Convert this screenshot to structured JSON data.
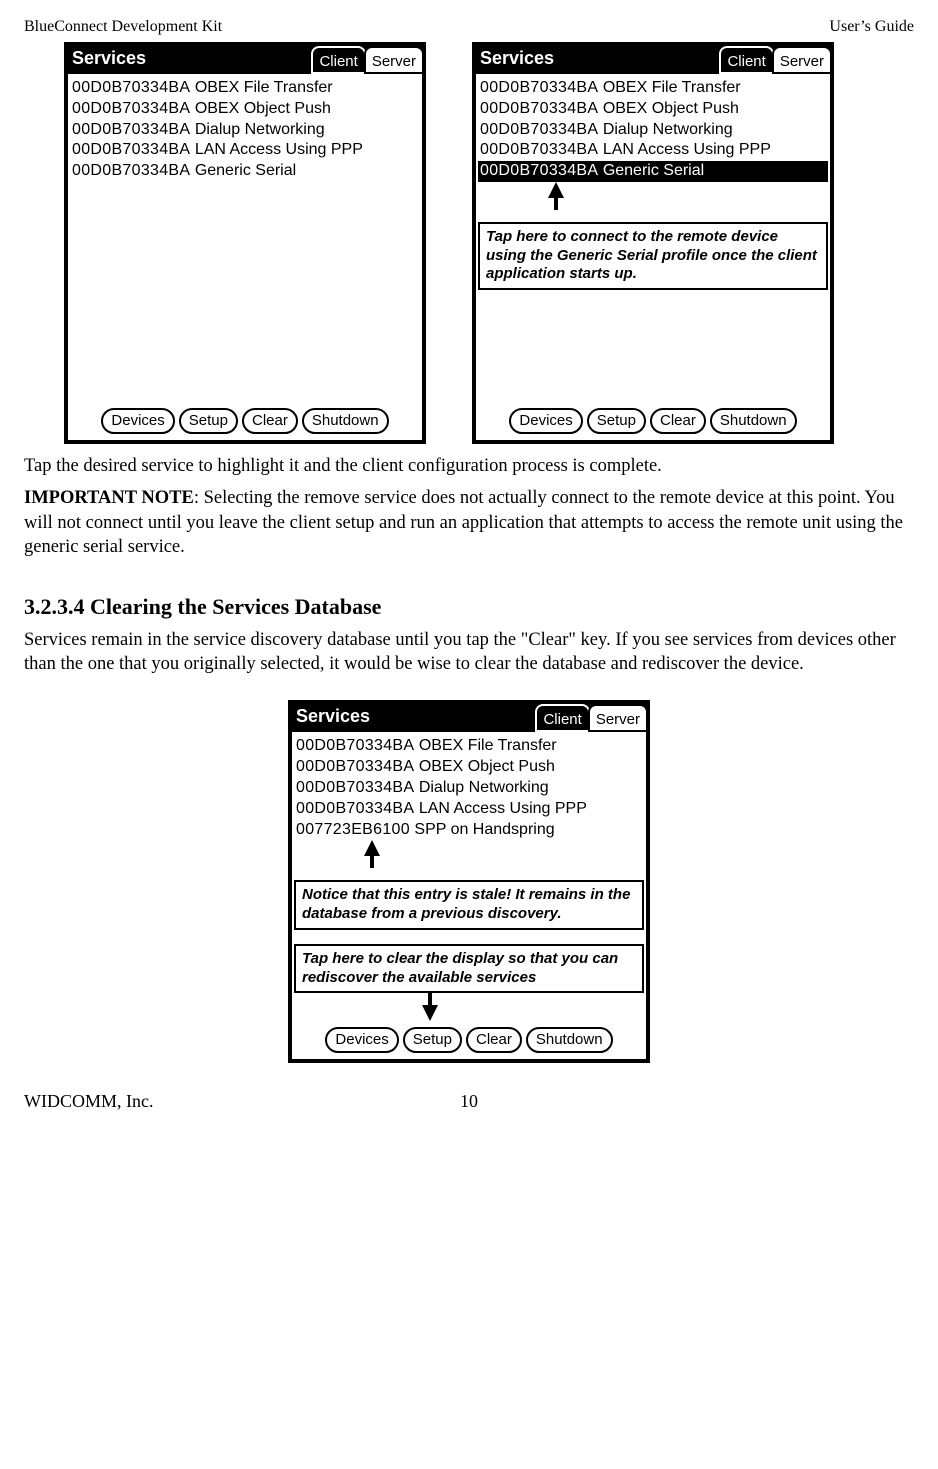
{
  "header": {
    "left": "BlueConnect Development Kit",
    "right": "User’s Guide"
  },
  "tabs": {
    "services": "Services",
    "client": "Client",
    "server": "Server"
  },
  "buttons": {
    "devices": "Devices",
    "setup": "Setup",
    "clear": "Clear",
    "shutdown": "Shutdown"
  },
  "svc_common": [
    {
      "mac": "00D0B70334BA",
      "name": "OBEX File Transfer"
    },
    {
      "mac": "00D0B70334BA",
      "name": "OBEX Object Push"
    },
    {
      "mac": "00D0B70334BA",
      "name": "Dialup Networking"
    },
    {
      "mac": "00D0B70334BA",
      "name": "LAN Access Using PPP"
    },
    {
      "mac": "00D0B70334BA",
      "name": "Generic Serial"
    }
  ],
  "svc_bottom": [
    {
      "mac": "00D0B70334BA",
      "name": "OBEX File Transfer"
    },
    {
      "mac": "00D0B70334BA",
      "name": "OBEX Object Push"
    },
    {
      "mac": "00D0B70334BA",
      "name": "Dialup Networking"
    },
    {
      "mac": "00D0B70334BA",
      "name": "LAN Access Using PPP"
    },
    {
      "mac": "007723EB6100",
      "name": " SPP on Handspring"
    }
  ],
  "callouts": {
    "select": "Tap here to connect to the remote device using the Generic Serial profile once the client application starts up.",
    "stale": "Notice that this entry is stale!  It remains in the database from a previous discovery.",
    "clear": "Tap here to clear the display so that you can rediscover the available services"
  },
  "body": {
    "p1": "Tap the desired service to highlight it and the client configuration process is complete.",
    "p2a": "IMPORTANT NOTE",
    "p2b": ":  Selecting the remove service does not actually connect to the remote device at this point.  You will not connect until you leave the client setup and run an application that attempts to access the remote unit using the generic serial service.",
    "h": "3.2.3.4 Clearing the Services Database",
    "p3": "Services remain in the service discovery database until you tap the \"Clear\" key.  If you see services from devices other than the one that you originally selected, it would be wise to clear the database and rediscover the device."
  },
  "footer": {
    "left": "WIDCOMM, Inc.",
    "page": "10"
  }
}
